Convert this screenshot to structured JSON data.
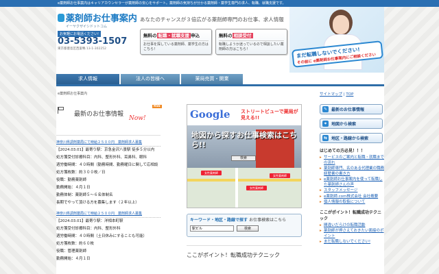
{
  "topbar": {
    "text": "e薬剤師お仕事案内はキャリアカウンセラーが薬剤師の安心をサポート。薬剤師の気持ちが分かる薬剤師・薬学生専門の求人、転職、就職支援です。"
  },
  "header": {
    "logo_name": "薬剤師お仕事案内",
    "logo_sub": "イーヤクザイシドットコム",
    "phone_label": "お気軽にお電話ください!",
    "phone": "03-5393-1507",
    "address": "東京都豊島区西巣鴨 13-1-302252",
    "tagline": "あなたのチャンスが３倍広がる薬剤師専門のお仕事、求人情報"
  },
  "promos": [
    {
      "hl": "転職・就職支援",
      "pre": "無料の",
      "post": "申込",
      "desc": "お仕事を探している薬剤師、薬学生の方はこちら！"
    },
    {
      "pre": "無料の",
      "hl": "相談受付",
      "post": "",
      "desc": "転職しようか迷っているので相談したい薬剤師の方はこちら！"
    }
  ],
  "callout": {
    "line1": "まだ転職しないでください!",
    "line2": "その前に e薬剤師お仕事案内にご相談ください"
  },
  "nav": {
    "tabs": [
      "求人情報",
      "法人の皆様へ",
      "薬局売買・開業"
    ],
    "active": 0
  },
  "breadcrumb": "e薬剤師お仕事案内",
  "toplinks": [
    "サイトマップ",
    "TOP"
  ],
  "news": {
    "title": "最新のお仕事情報",
    "now": "Now!",
    "rss": "RSS",
    "jobs": [
      {
        "title": "神奈川県調剤薬局にて時給２５００円　薬剤師求人募集",
        "lines": [
          "【2024.03.01】最寄り駅：京急金沢八景駅 徒歩５分以内",
          "処方箋受付診療科目：内科、整形外科、耳鼻科、眼科",
          "週労働時間：４０時間（勤務時間、勤務曜日に関して応相談",
          "処方箋枚数：約３００枚／日",
          "役職：勤務薬剤師",
          "勤務開始：４月１日",
          "勤務体制：薬剤師５～６名体制名",
          "長期でやって頂ける方を募集します（２年以上）"
        ]
      },
      {
        "title": "神奈川県調剤薬局にて時給２５００円　薬剤師求人募集",
        "lines": [
          "【2024.03.01】最寄り駅：洋相本町駅",
          "処方箋受付診療科目：内科、整形外科",
          "週労働時間：４０時間（土日休みにすることも可能）",
          "処方箋枚数：約６０枚",
          "役職：管理薬剤師",
          "勤務開始：４月１日"
        ]
      }
    ]
  },
  "mapbanner": {
    "google": "Google",
    "streetview": "ストリートビューで薬局が見える!!",
    "main": "地図から探すお仕事検索はこちら!!",
    "button": "検索",
    "pins": [
      "女性薬剤師",
      "女性薬剤師",
      "女性薬剤師"
    ]
  },
  "keyword": {
    "title": "キーワード・地区・路線で探す",
    "title2": "お仕事検索はこちら",
    "input_value": "駅ビル",
    "button": "検索"
  },
  "point_title": "ここがポイント！転職成功テクニック",
  "sidebar": {
    "buttons": [
      {
        "icon": "book-icon",
        "glyph": "✎",
        "label": "最新のお仕事情報"
      },
      {
        "icon": "map-icon",
        "glyph": "⌖",
        "label": "地図から検索"
      },
      {
        "icon": "train-icon",
        "glyph": "⇆",
        "label": "地区・路線から検索"
      }
    ],
    "firsttime": "はじめての方必見！！！",
    "links": [
      "サービスのご案内と転職・就職までの流れ",
      "薬剤師専門、名のある代理業の職務経歴書の書き方",
      "e薬剤師お仕事案内を使って転職した薬剤師さんの声",
      "スタッフメッセージ",
      "e薬剤師.com株式会社 会社概要",
      "個人情報の取扱について"
    ],
    "pointhead": "ここがポイント！転職成功テクニック",
    "links2": [
      "間違いだらけの転職活動",
      "薬剤師が押さえておきたい面接のポイント",
      "まだ転職しないでください!"
    ]
  }
}
